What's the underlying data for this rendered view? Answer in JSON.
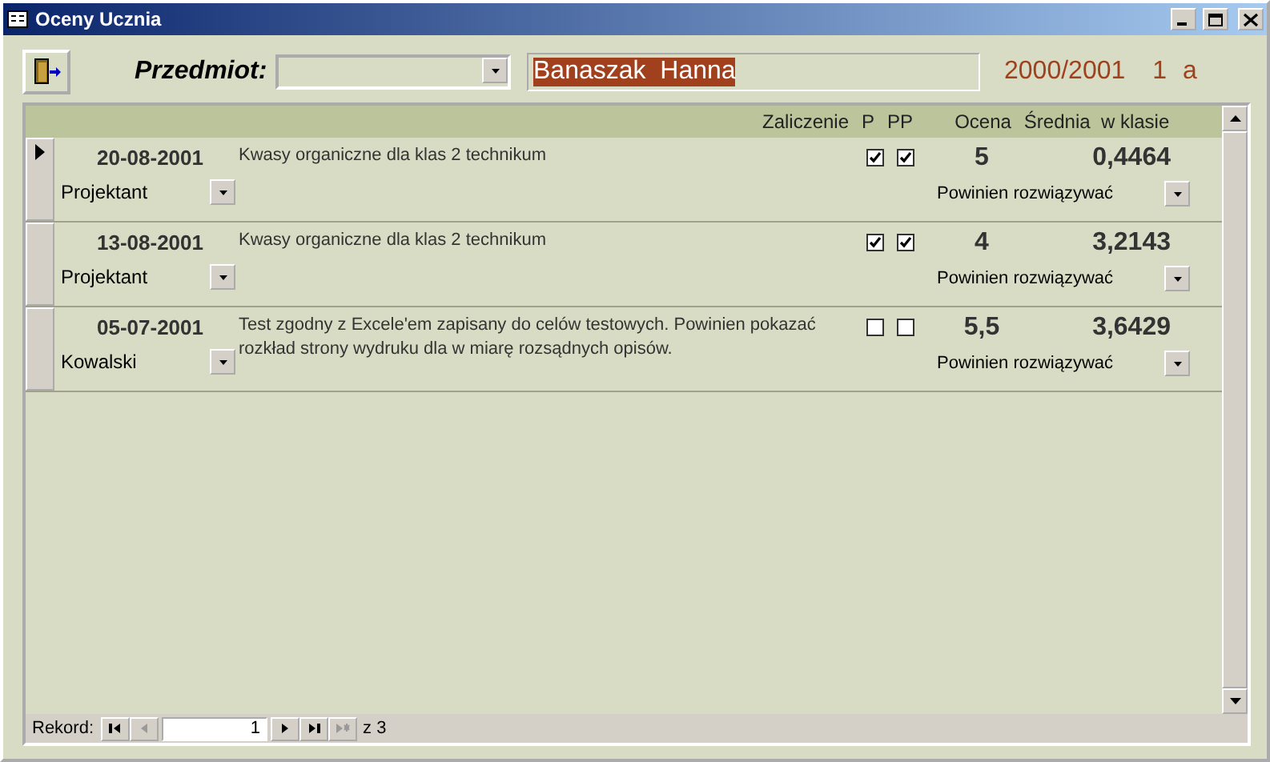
{
  "window": {
    "title": "Oceny Ucznia"
  },
  "header": {
    "subject_label": "Przedmiot:",
    "student": "Banaszak  Hanna",
    "student_selected": true,
    "year": "2000/2001",
    "class_number": "1",
    "class_letter": "a"
  },
  "columns": [
    "Zaliczenie",
    "P",
    "PP",
    "Ocena",
    "Średnia  w klasie"
  ],
  "rows": [
    {
      "date": "20-08-2001",
      "teacher": "Projektant",
      "description": "Kwasy organiczne dla klas 2 technikum",
      "p": true,
      "pp": true,
      "grade": "5",
      "average": "0,4464",
      "note": "Powinien rozwiązywać",
      "selected": true
    },
    {
      "date": "13-08-2001",
      "teacher": "Projektant",
      "description": "Kwasy organiczne dla klas 2 technikum",
      "p": true,
      "pp": true,
      "grade": "4",
      "average": "3,2143",
      "note": "Powinien rozwiązywać",
      "selected": false
    },
    {
      "date": "05-07-2001",
      "teacher": "Kowalski",
      "description": "Test zgodny z Excele'em zapisany do celów testowych. Powinien pokazać rozkład strony wydruku dla w miarę rozsądnych opisów.",
      "p": false,
      "pp": false,
      "grade": "5,5",
      "average": "3,6429",
      "note": "Powinien rozwiązywać",
      "selected": false
    }
  ],
  "navigator": {
    "label": "Rekord:",
    "current": "1",
    "total": "z 3",
    "buttons": [
      {
        "kind": "first",
        "disabled": false
      },
      {
        "kind": "prev",
        "disabled": true
      },
      {
        "kind": "next",
        "disabled": false
      },
      {
        "kind": "last",
        "disabled": false
      },
      {
        "kind": "new",
        "disabled": true
      }
    ]
  }
}
